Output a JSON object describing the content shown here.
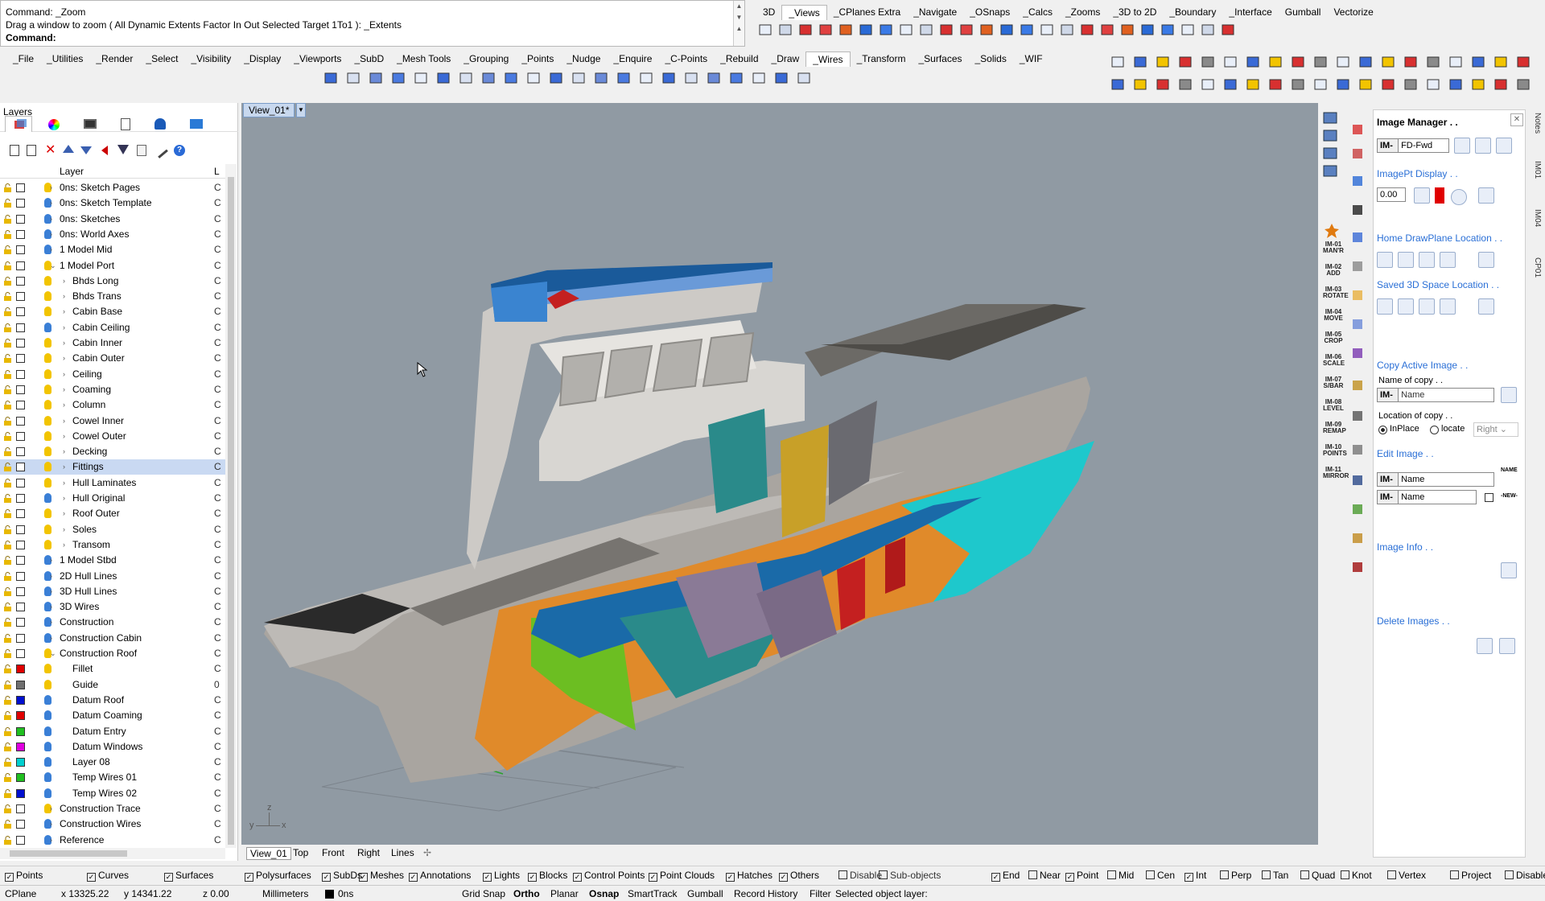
{
  "command": {
    "line1": "Command: _Zoom",
    "line2": "Drag a window to zoom ( All  Dynamic  Extents  Factor  In  Out  Selected  Target  1To1 ): _Extents",
    "prompt": "Command:"
  },
  "toolbar_tabs_top": [
    "3D",
    "_Views",
    "_CPlanes Extra",
    "_Navigate",
    "_OSnaps",
    "_Calcs",
    "_Zooms",
    "_3D to 2D",
    "_Boundary",
    "_Interface",
    "Gumball",
    "Vectorize"
  ],
  "toolbar_tabs_main": [
    "_File",
    "_Utilities",
    "_Render",
    "_Select",
    "_Visibility",
    "_Display",
    "_Viewports",
    "_SubD",
    "_Mesh Tools",
    "_Grouping",
    "_Points",
    "_Nudge",
    "_Enquire",
    "_C-Points",
    "_Rebuild",
    "_Draw",
    "_Wires",
    "_Transform",
    "_Surfaces",
    "_Solids",
    "_WIF"
  ],
  "layers": {
    "title": "Layers",
    "column_header": "Layer",
    "column_header2": "L",
    "rows": [
      {
        "name": "0ns: Sketch Pages",
        "level": 0,
        "exp": ">",
        "bulb": "#f2c400",
        "mat": "C"
      },
      {
        "name": "0ns: Sketch Template",
        "level": 0,
        "exp": ">",
        "bulb": "#3a7fd6",
        "mat": "C"
      },
      {
        "name": "0ns: Sketches",
        "level": 0,
        "exp": ">",
        "bulb": "#3a7fd6",
        "mat": "C"
      },
      {
        "name": "0ns: World Axes",
        "level": 0,
        "exp": ">",
        "bulb": "#3a7fd6",
        "mat": "C"
      },
      {
        "name": "1 Model Mid",
        "level": 0,
        "exp": ">",
        "bulb": "#3a7fd6",
        "mat": "C"
      },
      {
        "name": "1 Model Port",
        "level": 0,
        "exp": "v",
        "bulb": "#f2c400",
        "mat": "C"
      },
      {
        "name": "Bhds Long",
        "level": 1,
        "exp": ">",
        "bulb": "#f2c400",
        "mat": "C"
      },
      {
        "name": "Bhds Trans",
        "level": 1,
        "exp": ">",
        "bulb": "#f2c400",
        "mat": "C"
      },
      {
        "name": "Cabin Base",
        "level": 1,
        "exp": ">",
        "bulb": "#f2c400",
        "mat": "C"
      },
      {
        "name": "Cabin Ceiling",
        "level": 1,
        "exp": ">",
        "bulb": "#3a7fd6",
        "mat": "C"
      },
      {
        "name": "Cabin Inner",
        "level": 1,
        "exp": ">",
        "bulb": "#f2c400",
        "mat": "C"
      },
      {
        "name": "Cabin Outer",
        "level": 1,
        "exp": ">",
        "bulb": "#f2c400",
        "mat": "C"
      },
      {
        "name": "Ceiling",
        "level": 1,
        "exp": ">",
        "bulb": "#f2c400",
        "mat": "C"
      },
      {
        "name": "Coaming",
        "level": 1,
        "exp": ">",
        "bulb": "#f2c400",
        "mat": "C"
      },
      {
        "name": "Column",
        "level": 1,
        "exp": ">",
        "bulb": "#f2c400",
        "mat": "C"
      },
      {
        "name": "Cowel Inner",
        "level": 1,
        "exp": ">",
        "bulb": "#f2c400",
        "mat": "C"
      },
      {
        "name": "Cowel Outer",
        "level": 1,
        "exp": ">",
        "bulb": "#f2c400",
        "mat": "C"
      },
      {
        "name": "Decking",
        "level": 1,
        "exp": ">",
        "bulb": "#f2c400",
        "mat": "C"
      },
      {
        "name": "Fittings",
        "level": 1,
        "exp": ">",
        "bulb": "#f2c400",
        "mat": "C",
        "selected": true
      },
      {
        "name": "Hull Laminates",
        "level": 1,
        "exp": ">",
        "bulb": "#f2c400",
        "mat": "C"
      },
      {
        "name": "Hull Original",
        "level": 1,
        "exp": ">",
        "bulb": "#3a7fd6",
        "mat": "C"
      },
      {
        "name": "Roof Outer",
        "level": 1,
        "exp": ">",
        "bulb": "#f2c400",
        "mat": "C"
      },
      {
        "name": "Soles",
        "level": 1,
        "exp": ">",
        "bulb": "#f2c400",
        "mat": "C"
      },
      {
        "name": "Transom",
        "level": 1,
        "exp": ">",
        "bulb": "#f2c400",
        "mat": "C"
      },
      {
        "name": "1 Model Stbd",
        "level": 0,
        "exp": ">",
        "bulb": "#3a7fd6",
        "mat": "C"
      },
      {
        "name": "2D Hull Lines",
        "level": 0,
        "exp": ">",
        "bulb": "#3a7fd6",
        "mat": "C"
      },
      {
        "name": "3D Hull Lines",
        "level": 0,
        "exp": ">",
        "bulb": "#3a7fd6",
        "mat": "C"
      },
      {
        "name": "3D Wires",
        "level": 0,
        "exp": ">",
        "bulb": "#3a7fd6",
        "mat": "C"
      },
      {
        "name": "Construction",
        "level": 0,
        "exp": ">",
        "bulb": "#3a7fd6",
        "mat": "C"
      },
      {
        "name": "Construction Cabin",
        "level": 0,
        "exp": ">",
        "bulb": "#3a7fd6",
        "mat": "C"
      },
      {
        "name": "Construction Roof",
        "level": 0,
        "exp": "v",
        "bulb": "#f2c400",
        "mat": "C"
      },
      {
        "name": "Fillet",
        "level": 1,
        "exp": "",
        "bulb": "#f2c400",
        "mat": "C",
        "swatch": "#e00000"
      },
      {
        "name": "Guide",
        "level": 1,
        "exp": "",
        "bulb": "#f2c400",
        "mat": "0",
        "swatch": "#707070"
      },
      {
        "name": "Datum Roof",
        "level": 1,
        "exp": "",
        "bulb": "#3a7fd6",
        "mat": "C",
        "swatch": "#0010d0"
      },
      {
        "name": "Datum Coaming",
        "level": 1,
        "exp": "",
        "bulb": "#3a7fd6",
        "mat": "C",
        "swatch": "#e00000"
      },
      {
        "name": "Datum Entry",
        "level": 1,
        "exp": "",
        "bulb": "#3a7fd6",
        "mat": "C",
        "swatch": "#20c020"
      },
      {
        "name": "Datum Windows",
        "level": 1,
        "exp": "",
        "bulb": "#3a7fd6",
        "mat": "C",
        "swatch": "#e000e0"
      },
      {
        "name": "Layer 08",
        "level": 1,
        "exp": "",
        "bulb": "#3a7fd6",
        "mat": "C",
        "swatch": "#00d0d0"
      },
      {
        "name": "Temp Wires 01",
        "level": 1,
        "exp": "",
        "bulb": "#3a7fd6",
        "mat": "C",
        "swatch": "#20c020"
      },
      {
        "name": "Temp Wires 02",
        "level": 1,
        "exp": "",
        "bulb": "#3a7fd6",
        "mat": "C",
        "swatch": "#0010d0"
      },
      {
        "name": "Construction Trace",
        "level": 0,
        "exp": ">",
        "bulb": "#f2c400",
        "mat": "C"
      },
      {
        "name": "Construction Wires",
        "level": 0,
        "exp": ">",
        "bulb": "#3a7fd6",
        "mat": "C"
      },
      {
        "name": "Reference",
        "level": 0,
        "exp": ">",
        "bulb": "#3a7fd6",
        "mat": "C"
      }
    ]
  },
  "viewport": {
    "title": "View_01*",
    "tabs": [
      "View_01",
      "Top",
      "Front",
      "Right",
      "Lines"
    ]
  },
  "image_manager": {
    "title": "Image Manager . .",
    "im_prefix": "IM-",
    "im_value": "FD-Fwd",
    "imagept_display": "ImagePt Display . .",
    "display_value": "0.00",
    "home_drawplane": "Home DrawPlane Location . .",
    "saved_3d": "Saved 3D Space Location . .",
    "copy_active": "Copy Active Image . .",
    "name_of_copy": "Name of copy . .",
    "name_placeholder": "Name",
    "location_of_copy": "Location of copy . .",
    "radio_inplace": "InPlace",
    "radio_locate": "locate",
    "direction": "Right",
    "edit_image": "Edit Image . .",
    "image_info": "Image Info . .",
    "delete_images": "Delete Images . .",
    "name_btn": "NAME",
    "new_btn": "-NEW-"
  },
  "im_strip": [
    "IM-01 MAN'R",
    "IM-02 ADD",
    "IM-03 ROTATE",
    "IM-04 MOVE",
    "IM-05 CROP",
    "IM-06 SCALE",
    "IM-07 S/BAR",
    "IM-08 LEVEL",
    "IM-09 REMAP",
    "IM-10 POINTS",
    "IM-11 MIRROR"
  ],
  "side_tabs": [
    "Notes",
    "IM01",
    "IM04",
    "CP01"
  ],
  "filters": {
    "left": [
      {
        "label": "Points",
        "checked": true
      },
      {
        "label": "Curves",
        "checked": true
      },
      {
        "label": "Surfaces",
        "checked": true
      },
      {
        "label": "Polysurfaces",
        "checked": true
      },
      {
        "label": "SubDs",
        "checked": true
      },
      {
        "label": "Meshes",
        "checked": true
      },
      {
        "label": "Annotations",
        "checked": true
      },
      {
        "label": "Lights",
        "checked": true
      },
      {
        "label": "Blocks",
        "checked": true
      },
      {
        "label": "Control Points",
        "checked": true
      },
      {
        "label": "Point Clouds",
        "checked": true
      },
      {
        "label": "Hatches",
        "checked": true
      },
      {
        "label": "Others",
        "checked": true
      },
      {
        "label": "Disable",
        "checked": false
      },
      {
        "label": "Sub-objects",
        "checked": false
      }
    ],
    "right": [
      {
        "label": "End",
        "checked": true
      },
      {
        "label": "Near",
        "checked": false
      },
      {
        "label": "Point",
        "checked": true
      },
      {
        "label": "Mid",
        "checked": false
      },
      {
        "label": "Cen",
        "checked": false
      },
      {
        "label": "Int",
        "checked": true
      },
      {
        "label": "Perp",
        "checked": false
      },
      {
        "label": "Tan",
        "checked": false
      },
      {
        "label": "Quad",
        "checked": false
      },
      {
        "label": "Knot",
        "checked": false
      },
      {
        "label": "Vertex",
        "checked": false
      },
      {
        "label": "Project",
        "checked": false
      },
      {
        "label": "Disable",
        "checked": false
      }
    ]
  },
  "status": {
    "cplane": "CPlane",
    "x": "x 13325.22",
    "y": "y 14341.22",
    "z": "z 0.00",
    "units": "Millimeters",
    "layer": "0ns",
    "grid_snap": "Grid Snap",
    "ortho": "Ortho",
    "planar": "Planar",
    "osnap": "Osnap",
    "smarttrack": "SmartTrack",
    "gumball": "Gumball",
    "record_history": "Record History",
    "filter": "Filter",
    "message": "Selected object layer:"
  },
  "axes": {
    "x": "x",
    "y": "y",
    "z": "z"
  }
}
